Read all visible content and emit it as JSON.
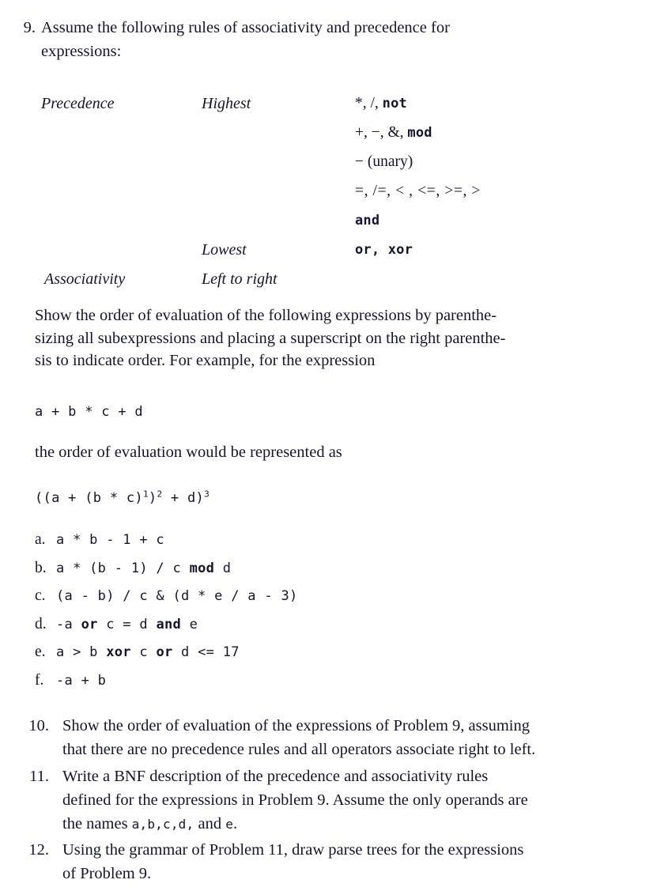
{
  "problems": {
    "nine": {
      "number": "9.",
      "intro_line1": "Assume the following rules of associativity and precedence for",
      "intro_line2": "expressions:",
      "table": {
        "precedence_label": "Precedence",
        "associativity_label": "Associativity",
        "highest_label": "Highest",
        "lowest_label": "Lowest",
        "associativity_value": "Left to right",
        "rows": [
          {
            "symbols": "*, /, ",
            "keyword": "not",
            "tail": ""
          },
          {
            "symbols": "+, −, &, ",
            "keyword": "mod",
            "tail": ""
          },
          {
            "symbols": "− (unary)",
            "keyword": "",
            "tail": ""
          },
          {
            "symbols": "=, /=, < , <=, >=, >",
            "keyword": "",
            "tail": ""
          },
          {
            "symbols": "",
            "keyword": "and",
            "tail": ""
          },
          {
            "symbols": "",
            "keyword": "or, xor",
            "tail": ""
          }
        ]
      },
      "body_line1": "Show the order of evaluation of the following expressions by parenthe-",
      "body_line2": "sizing all subexpressions and placing a superscript on the right parenthe-",
      "body_line3": "sis to indicate order. For example, for the expression",
      "example_expression": "a + b * c + d",
      "body_line4": "the order of evaluation would be represented as",
      "result_expression": {
        "part1": "((a + (b * c)",
        "sup1": "1",
        "part2": ")",
        "sup2": "2",
        "part3": " + d)",
        "sup3": "3"
      },
      "items": [
        {
          "label": "a.",
          "pre": "a * b - 1 + c",
          "bold": "",
          "post": ""
        },
        {
          "label": "b.",
          "pre": "a * (b - 1) / c ",
          "bold": "mod",
          "post": " d"
        },
        {
          "label": "c.",
          "pre": "(a - b) / c & (d * e / a - 3)",
          "bold": "",
          "post": ""
        },
        {
          "label": "d.",
          "pre": "-a ",
          "bold": "or",
          "post": " c = d ",
          "bold2": "and",
          "post2": " e"
        },
        {
          "label": "e.",
          "pre": "a > b ",
          "bold": "xor",
          "post": " c ",
          "bold2": "or",
          "post2": " d <= 17"
        },
        {
          "label": "f.",
          "pre": "-a + b",
          "bold": "",
          "post": ""
        }
      ]
    },
    "ten": {
      "number": "10.",
      "line1": "Show the order of evaluation of the expressions of Problem 9, assuming",
      "line2": "that there are no precedence rules and all operators associate right to left."
    },
    "eleven": {
      "number": "11.",
      "line1": "Write a BNF description of the precedence and associativity rules",
      "line2": "defined for the expressions in Problem 9. Assume the only operands are",
      "line3_pre": "the names ",
      "line3_mono": "a,b,c,d,",
      "line3_mid": " and ",
      "line3_mono2": "e",
      "line3_post": "."
    },
    "twelve": {
      "number": "12.",
      "line1": "Using the grammar of Problem 11, draw parse trees for the expressions",
      "line2": "of Problem 9."
    }
  }
}
